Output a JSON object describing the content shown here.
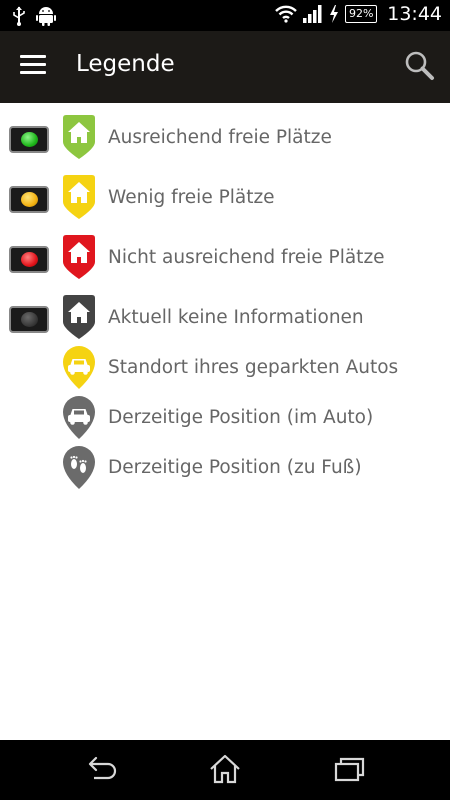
{
  "status_bar": {
    "time": "13:44",
    "battery": "92%",
    "icons": [
      "usb-icon",
      "android-icon",
      "wifi-icon",
      "signal-icon",
      "charging-icon",
      "battery-icon"
    ]
  },
  "app_bar": {
    "title": "Legende",
    "menu_icon": "hamburger-menu-icon",
    "search_icon": "search-icon",
    "background": "#1c1a17"
  },
  "legend": {
    "items": [
      {
        "label": "Ausreichend freie Plätze",
        "light": "green",
        "pin": "house",
        "pin_color": "#8dc63f",
        "lamp_color": "#22c41e"
      },
      {
        "label": "Wenig freie Plätze",
        "light": "yellow",
        "pin": "house",
        "pin_color": "#f5d312",
        "lamp_color": "#f3b212"
      },
      {
        "label": "Nicht ausreichend freie Plätze",
        "light": "red",
        "pin": "house",
        "pin_color": "#e0161e",
        "lamp_color": "#e3141b"
      },
      {
        "label": "Aktuell keine Informationen",
        "light": "gray",
        "pin": "house",
        "pin_color": "#444444",
        "lamp_color": "#3a3a3a"
      },
      {
        "label": "Standort ihres geparkten Autos",
        "light": null,
        "pin": "car",
        "pin_color": "#f5d312"
      },
      {
        "label": "Derzeitige Position (im Auto)",
        "light": null,
        "pin": "car",
        "pin_color": "#6b6b6b"
      },
      {
        "label": "Derzeitige Position (zu Fuß)",
        "light": null,
        "pin": "footprints",
        "pin_color": "#6b6b6b"
      }
    ]
  },
  "nav_bar": {
    "buttons": [
      "back-icon",
      "home-icon",
      "recent-apps-icon"
    ]
  }
}
